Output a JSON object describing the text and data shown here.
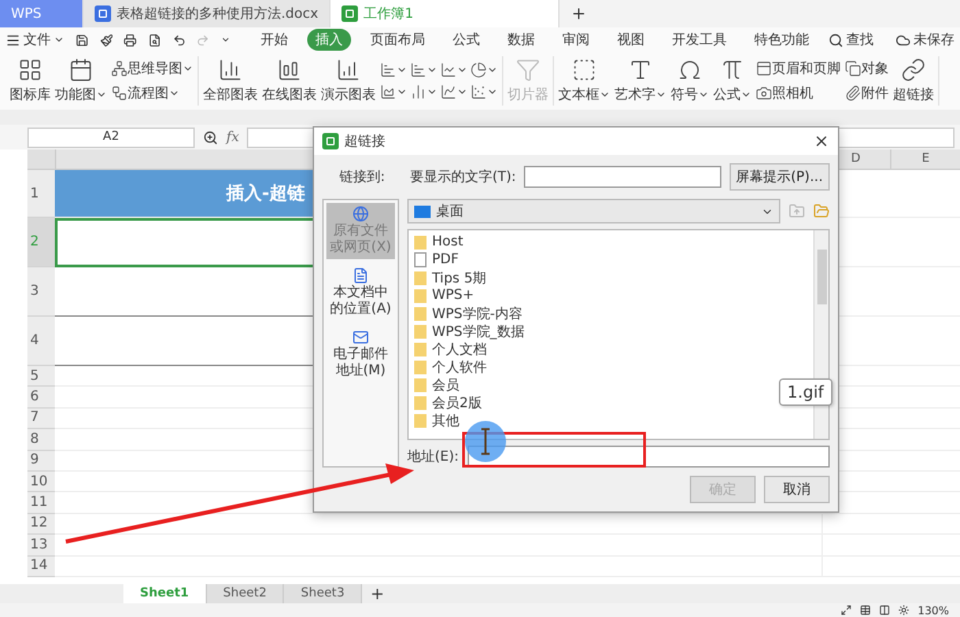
{
  "tabs": [
    {
      "label": "WPS",
      "kind": "home",
      "selected": false
    },
    {
      "label": "表格超链接的多种使用方法.docx",
      "kind": "writer",
      "selected": false
    },
    {
      "label": "工作簿1",
      "kind": "sheet",
      "selected": true
    }
  ],
  "menu": {
    "file": "文件",
    "tabs": [
      {
        "label": "开始",
        "selected": false
      },
      {
        "label": "插入",
        "selected": true
      },
      {
        "label": "页面布局",
        "selected": false
      },
      {
        "label": "公式",
        "selected": false
      },
      {
        "label": "数据",
        "selected": false
      },
      {
        "label": "审阅",
        "selected": false
      },
      {
        "label": "视图",
        "selected": false
      },
      {
        "label": "开发工具",
        "selected": false
      },
      {
        "label": "特色功能",
        "selected": false
      }
    ],
    "search": "查找",
    "save_status": "未保存"
  },
  "ribbon": [
    [
      {
        "kind": "large",
        "label": "图标库",
        "dropdown": false
      },
      {
        "kind": "large",
        "label": "功能图",
        "dropdown": true
      },
      {
        "kind": "stack",
        "items": [
          {
            "label": "思维导图",
            "dropdown": true
          },
          {
            "label": "流程图",
            "dropdown": true
          }
        ]
      }
    ],
    [
      {
        "kind": "large",
        "label": "全部图表",
        "dropdown": false
      },
      {
        "kind": "large",
        "label": "在线图表",
        "dropdown": false
      },
      {
        "kind": "large",
        "label": "演示图表",
        "dropdown": false
      },
      {
        "kind": "icons",
        "items": [
          {
            "dropdown": true
          },
          {
            "dropdown": true
          },
          {
            "dropdown": true
          },
          {
            "dropdown": true
          },
          {
            "dropdown": true
          },
          {
            "dropdown": true
          },
          {
            "dropdown": true
          },
          {
            "dropdown": true
          }
        ]
      }
    ],
    [
      {
        "kind": "large",
        "label": "切片器",
        "dropdown": false,
        "disabled": true
      }
    ],
    [
      {
        "kind": "large",
        "label": "文本框",
        "dropdown": true
      },
      {
        "kind": "large",
        "label": "艺术字",
        "dropdown": true
      },
      {
        "kind": "large",
        "label": "符号",
        "dropdown": true
      },
      {
        "kind": "large",
        "label": "公式",
        "dropdown": true
      },
      {
        "kind": "stack",
        "items": [
          {
            "label": "页眉和页脚",
            "dropdown": false
          },
          {
            "label": "照相机",
            "dropdown": false
          }
        ]
      },
      {
        "kind": "stack",
        "items": [
          {
            "label": "对象",
            "dropdown": false
          },
          {
            "label": "附件",
            "dropdown": false
          }
        ]
      },
      {
        "kind": "large",
        "label": "超链接",
        "dropdown": false
      }
    ]
  ],
  "formula_bar": {
    "cell": "A2",
    "fx": "fx"
  },
  "grid": {
    "columns": [
      "D",
      "E"
    ],
    "rows": [
      {
        "number": "1",
        "kind": "title",
        "text": "插入-超链",
        "selected": false
      },
      {
        "number": "2",
        "kind": "tall",
        "selected": true
      },
      {
        "number": "3",
        "kind": "tall",
        "selected": false
      },
      {
        "number": "4",
        "kind": "tall",
        "selected": false
      },
      {
        "number": "5",
        "kind": "normal",
        "selected": false
      },
      {
        "number": "6",
        "kind": "normal",
        "selected": false
      },
      {
        "number": "7",
        "kind": "normal",
        "selected": false
      },
      {
        "number": "8",
        "kind": "normal",
        "selected": false
      },
      {
        "number": "9",
        "kind": "normal",
        "selected": false
      },
      {
        "number": "10",
        "kind": "normal",
        "selected": false
      },
      {
        "number": "11",
        "kind": "normal",
        "selected": false
      },
      {
        "number": "12",
        "kind": "normal",
        "selected": false
      },
      {
        "number": "13",
        "kind": "normal",
        "selected": false
      },
      {
        "number": "14",
        "kind": "normal",
        "selected": false
      }
    ]
  },
  "sheets": [
    {
      "label": "Sheet1",
      "selected": true
    },
    {
      "label": "Sheet2",
      "selected": false
    },
    {
      "label": "Sheet3",
      "selected": false
    }
  ],
  "sheet_add": "+",
  "status_bar": {
    "zoom": "130%"
  },
  "dialog": {
    "title": "超链接",
    "link_to": "链接到:",
    "display_label": "要显示的文字(T):",
    "tip_button": "屏幕提示(P)...",
    "nav": [
      {
        "label": "原有文件或网页(X)",
        "selected": true
      },
      {
        "label": "本文档中的位置(A)",
        "selected": false
      },
      {
        "label": "电子邮件地址(M)",
        "selected": false
      }
    ],
    "folder": "桌面",
    "files": [
      {
        "name": "Host",
        "kind": "folder"
      },
      {
        "name": "PDF",
        "kind": "file"
      },
      {
        "name": "Tips 5期",
        "kind": "folder"
      },
      {
        "name": "WPS+",
        "kind": "folder"
      },
      {
        "name": "WPS学院-内容",
        "kind": "folder"
      },
      {
        "name": "WPS学院_数据",
        "kind": "folder"
      },
      {
        "name": "个人文档",
        "kind": "folder"
      },
      {
        "name": "个人软件",
        "kind": "folder"
      },
      {
        "name": "会员",
        "kind": "folder"
      },
      {
        "name": "会员2版",
        "kind": "folder"
      },
      {
        "name": "其他",
        "kind": "folder"
      }
    ],
    "address_label": "地址(E):",
    "buttons": [
      {
        "label": "确定",
        "disabled": true
      },
      {
        "label": "取消",
        "disabled": false
      }
    ]
  },
  "tooltip": "1.gif"
}
